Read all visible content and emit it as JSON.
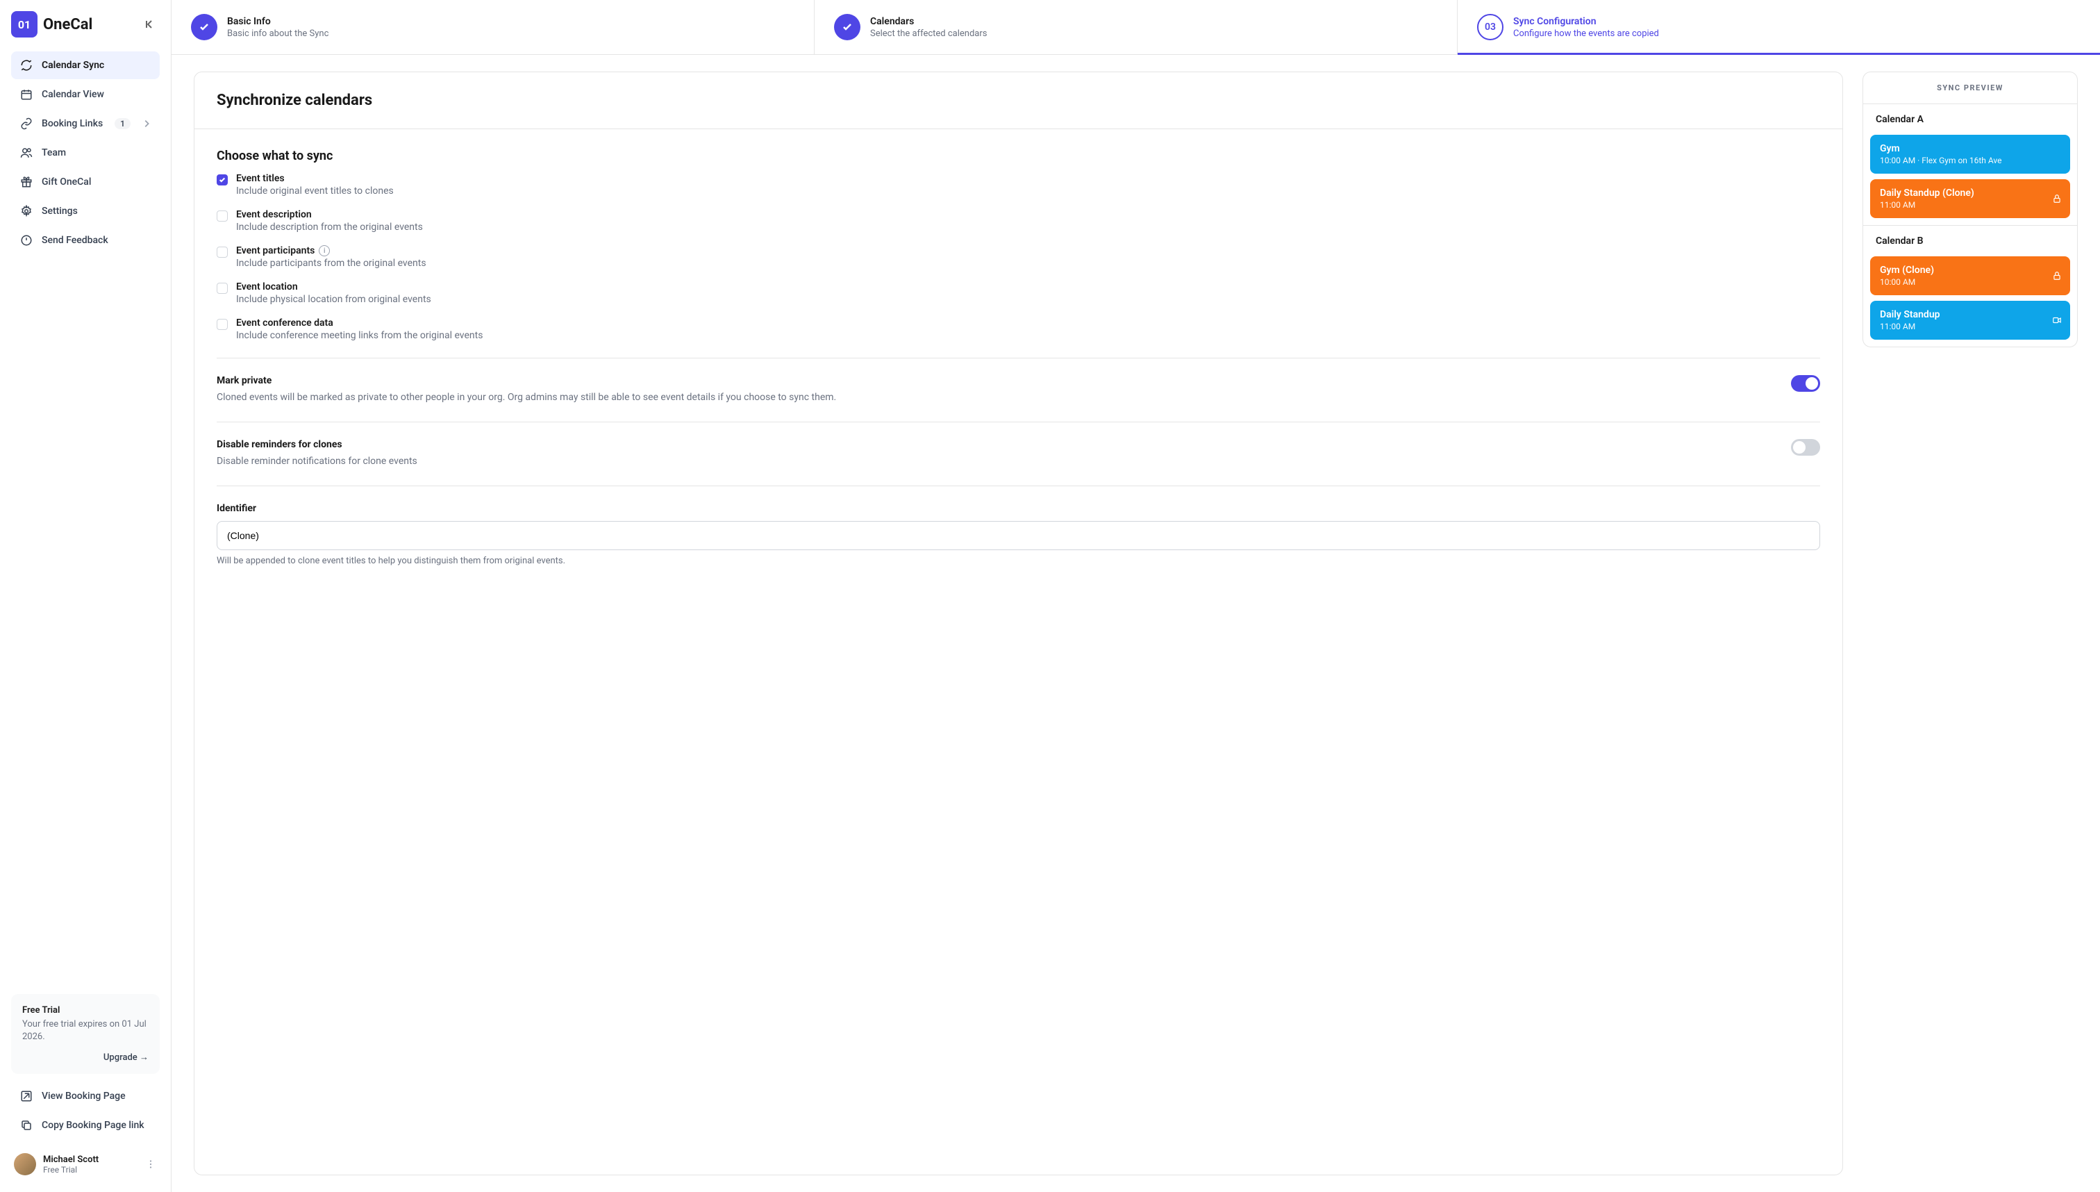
{
  "logo": {
    "box": "01",
    "name": "OneCal"
  },
  "nav": {
    "items": [
      {
        "label": "Calendar Sync"
      },
      {
        "label": "Calendar View"
      },
      {
        "label": "Booking Links",
        "badge": "1"
      },
      {
        "label": "Team"
      },
      {
        "label": "Gift OneCal"
      },
      {
        "label": "Settings"
      },
      {
        "label": "Send Feedback"
      }
    ],
    "bottom": [
      {
        "label": "View Booking Page"
      },
      {
        "label": "Copy Booking Page link"
      }
    ]
  },
  "trial": {
    "title": "Free Trial",
    "text": "Your free trial expires on 01 Jul 2026.",
    "cta": "Upgrade →"
  },
  "user": {
    "name": "Michael Scott",
    "plan": "Free Trial"
  },
  "steps": [
    {
      "title": "Basic Info",
      "sub": "Basic info about the Sync"
    },
    {
      "title": "Calendars",
      "sub": "Select the affected calendars"
    },
    {
      "num": "03",
      "title": "Sync Configuration",
      "sub": "Configure how the events are copied"
    }
  ],
  "config": {
    "header": "Synchronize calendars",
    "choose_title": "Choose what to sync",
    "options": [
      {
        "label": "Event titles",
        "desc": "Include original event titles to clones",
        "checked": true
      },
      {
        "label": "Event description",
        "desc": "Include description from the original events",
        "checked": false
      },
      {
        "label": "Event participants",
        "desc": "Include participants from the original events",
        "checked": false,
        "info": true
      },
      {
        "label": "Event location",
        "desc": "Include physical location from original events",
        "checked": false
      },
      {
        "label": "Event conference data",
        "desc": "Include conference meeting links from the original events",
        "checked": false
      }
    ],
    "private": {
      "title": "Mark private",
      "desc": "Cloned events will be marked as private to other people in your org. Org admins may still be able to see event details if you choose to sync them."
    },
    "reminders": {
      "title": "Disable reminders for clones",
      "desc": "Disable reminder notifications for clone events"
    },
    "identifier": {
      "label": "Identifier",
      "value": "(Clone)",
      "hint": "Will be appended to clone event titles to help you distinguish them from original events."
    }
  },
  "preview": {
    "header": "SYNC PREVIEW",
    "calA": {
      "name": "Calendar A",
      "events": [
        {
          "title": "Gym",
          "sub": "10:00 AM · Flex Gym on 16th Ave",
          "color": "blue"
        },
        {
          "title": "Daily Standup (Clone)",
          "sub": "11:00 AM",
          "color": "orange",
          "lock": true
        }
      ]
    },
    "calB": {
      "name": "Calendar B",
      "events": [
        {
          "title": "Gym (Clone)",
          "sub": "10:00 AM",
          "color": "orange",
          "lock": true
        },
        {
          "title": "Daily Standup",
          "sub": "11:00 AM",
          "color": "blue",
          "video": true
        }
      ]
    }
  }
}
